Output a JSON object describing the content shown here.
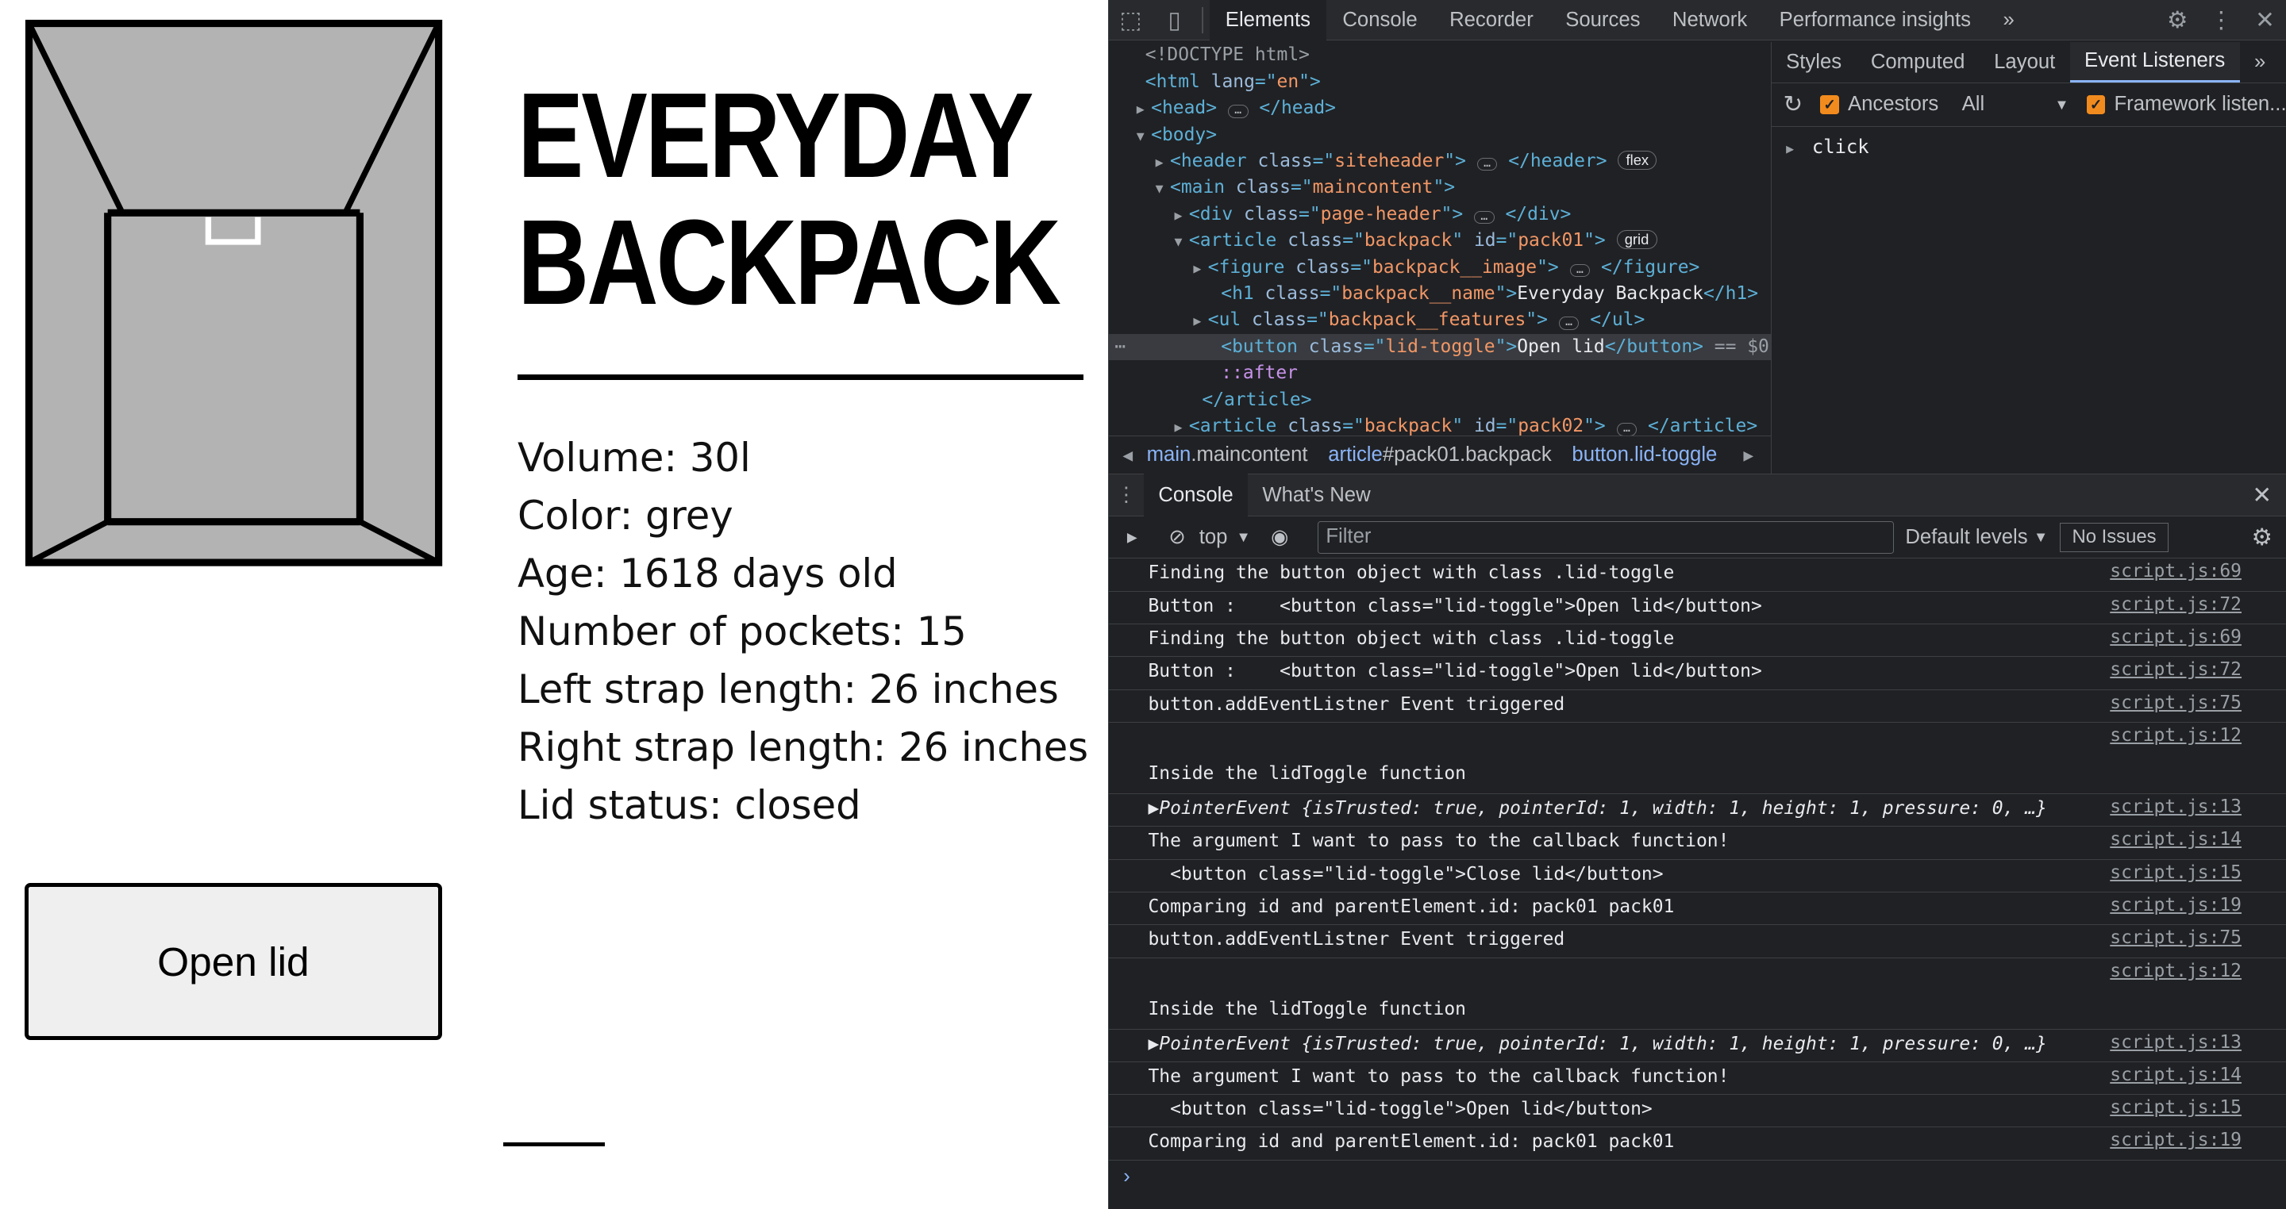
{
  "page": {
    "title": "EVERYDAY BACKPACK",
    "features": [
      "Volume: 30l",
      "Color: grey",
      "Age: 1618 days old",
      "Number of pockets: 15",
      "Left strap length: 26 inches",
      "Right strap length: 26 inches",
      "Lid status: closed"
    ],
    "lid_button": "Open lid"
  },
  "devtools": {
    "main_tabs": [
      "Elements",
      "Console",
      "Recorder",
      "Sources",
      "Network",
      "Performance insights"
    ],
    "more_tabs": "»",
    "elements_tree": [
      {
        "tokens": [
          {
            "c": "cm",
            "t": "<!DOCTYPE html>"
          }
        ]
      },
      {
        "tokens": [
          {
            "c": "tg",
            "t": "<html "
          },
          {
            "c": "an",
            "t": "lang"
          },
          {
            "c": "tg",
            "t": "=\""
          },
          {
            "c": "av",
            "t": "en"
          },
          {
            "c": "tg",
            "t": "\">"
          }
        ]
      },
      {
        "tri": "▶",
        "tokens": [
          {
            "c": "tg",
            "t": "<head>"
          }
        ],
        "ellipsis": true,
        "tail": [
          {
            "c": "tg",
            "t": "</head>"
          }
        ]
      },
      {
        "tri": "▼",
        "tokens": [
          {
            "c": "tg",
            "t": "<body>"
          }
        ]
      },
      {
        "tri": "▶",
        "tokens": [
          {
            "c": "tg",
            "t": "<header "
          },
          {
            "c": "an",
            "t": "class"
          },
          {
            "c": "tg",
            "t": "=\""
          },
          {
            "c": "av",
            "t": "siteheader"
          },
          {
            "c": "tg",
            "t": "\">"
          }
        ],
        "ellipsis": true,
        "tail": [
          {
            "c": "tg",
            "t": "</header>"
          }
        ],
        "badge": "flex"
      },
      {
        "tri": "▼",
        "tokens": [
          {
            "c": "tg",
            "t": "<main "
          },
          {
            "c": "an",
            "t": "class"
          },
          {
            "c": "tg",
            "t": "=\""
          },
          {
            "c": "av",
            "t": "maincontent"
          },
          {
            "c": "tg",
            "t": "\">"
          }
        ]
      },
      {
        "tri": "▶",
        "tokens": [
          {
            "c": "tg",
            "t": "<div "
          },
          {
            "c": "an",
            "t": "class"
          },
          {
            "c": "tg",
            "t": "=\""
          },
          {
            "c": "av",
            "t": "page-header"
          },
          {
            "c": "tg",
            "t": "\">"
          }
        ],
        "ellipsis": true,
        "tail": [
          {
            "c": "tg",
            "t": "</div>"
          }
        ]
      },
      {
        "tri": "▼",
        "tokens": [
          {
            "c": "tg",
            "t": "<article "
          },
          {
            "c": "an",
            "t": "class"
          },
          {
            "c": "tg",
            "t": "=\""
          },
          {
            "c": "av",
            "t": "backpack"
          },
          {
            "c": "tg",
            "t": "\" "
          },
          {
            "c": "an",
            "t": "id"
          },
          {
            "c": "tg",
            "t": "=\""
          },
          {
            "c": "av",
            "t": "pack01"
          },
          {
            "c": "tg",
            "t": "\">"
          }
        ],
        "badge": "grid"
      },
      {
        "tri": "▶",
        "tokens": [
          {
            "c": "tg",
            "t": "<figure "
          },
          {
            "c": "an",
            "t": "class"
          },
          {
            "c": "tg",
            "t": "=\""
          },
          {
            "c": "av",
            "t": "backpack__image"
          },
          {
            "c": "tg",
            "t": "\">"
          }
        ],
        "ellipsis": true,
        "tail": [
          {
            "c": "tg",
            "t": "</figure>"
          }
        ]
      },
      {
        "tokens": [
          {
            "c": "tg",
            "t": "<h1 "
          },
          {
            "c": "an",
            "t": "class"
          },
          {
            "c": "tg",
            "t": "=\""
          },
          {
            "c": "av",
            "t": "backpack__name"
          },
          {
            "c": "tg",
            "t": "\">"
          },
          {
            "c": "tx",
            "t": "Everyday Backpack"
          },
          {
            "c": "tg",
            "t": "</h1>"
          }
        ]
      },
      {
        "tri": "▶",
        "tokens": [
          {
            "c": "tg",
            "t": "<ul "
          },
          {
            "c": "an",
            "t": "class"
          },
          {
            "c": "tg",
            "t": "=\""
          },
          {
            "c": "av",
            "t": "backpack__features"
          },
          {
            "c": "tg",
            "t": "\">"
          }
        ],
        "ellipsis": true,
        "tail": [
          {
            "c": "tg",
            "t": "</ul>"
          }
        ]
      },
      {
        "sel": true,
        "tokens": [
          {
            "c": "tg",
            "t": "<button "
          },
          {
            "c": "an",
            "t": "class"
          },
          {
            "c": "tg",
            "t": "=\""
          },
          {
            "c": "av",
            "t": "lid-toggle"
          },
          {
            "c": "tg",
            "t": "\">"
          },
          {
            "c": "tx",
            "t": "Open lid"
          },
          {
            "c": "tg",
            "t": "</button>"
          },
          {
            "c": "cm",
            "t": " == $0"
          }
        ]
      },
      {
        "tokens": [
          {
            "c": "ps",
            "t": "::after"
          }
        ]
      },
      {
        "tokens": [
          {
            "c": "tg",
            "t": "</article>"
          }
        ]
      },
      {
        "tri": "▶",
        "tokens": [
          {
            "c": "tg",
            "t": "<article "
          },
          {
            "c": "an",
            "t": "class"
          },
          {
            "c": "tg",
            "t": "=\""
          },
          {
            "c": "av",
            "t": "backpack"
          },
          {
            "c": "tg",
            "t": "\" "
          },
          {
            "c": "an",
            "t": "id"
          },
          {
            "c": "tg",
            "t": "=\""
          },
          {
            "c": "av",
            "t": "pack02"
          },
          {
            "c": "tg",
            "t": "\">"
          }
        ],
        "ellipsis": true,
        "tail": [
          {
            "c": "tg",
            "t": "</article>"
          }
        ]
      }
    ],
    "breadcrumbs": [
      {
        "a": "main",
        "b": ".maincontent"
      },
      {
        "a": "article",
        "b": "#pack01.backpack"
      },
      {
        "a": "button",
        "b": ".lid-toggle"
      }
    ],
    "side_tabs": [
      "Styles",
      "Computed",
      "Layout",
      "Event Listeners"
    ],
    "side_more": "»",
    "ancestors_label": "Ancestors",
    "all_label": "All",
    "framework_label": "Framework listen...",
    "event_name": "click",
    "drawer_tabs": [
      "Console",
      "What's New"
    ],
    "context": "top",
    "filter_placeholder": "Filter",
    "levels": "Default levels",
    "no_issues": "No Issues",
    "console_lines": [
      {
        "text": "Finding the button object with class .lid-toggle",
        "src": "script.js:69"
      },
      {
        "text": "Button :    <button class=\"lid-toggle\">Open lid</button>",
        "src": "script.js:72"
      },
      {
        "text": "Finding the button object with class .lid-toggle",
        "src": "script.js:69"
      },
      {
        "text": "Button :    <button class=\"lid-toggle\">Open lid</button>",
        "src": "script.js:72"
      },
      {
        "text": "button.addEventListner Event triggered",
        "src": "script.js:75"
      },
      {
        "text": "Inside the lidToggle function",
        "src": "script.js:12",
        "tall": true
      },
      {
        "text": "▶PointerEvent {isTrusted: true, pointerId: 1, width: 1, height: 1, pressure: 0, …}",
        "src": "script.js:13",
        "obj": true
      },
      {
        "text": "The argument I want to pass to the callback function!",
        "src": "script.js:14"
      },
      {
        "text": "  <button class=\"lid-toggle\">Close lid</button>",
        "src": "script.js:15"
      },
      {
        "text": "Comparing id and parentElement.id: pack01 pack01",
        "src": "script.js:19"
      },
      {
        "text": "button.addEventListner Event triggered",
        "src": "script.js:75"
      },
      {
        "text": "Inside the lidToggle function",
        "src": "script.js:12",
        "tall": true
      },
      {
        "text": "▶PointerEvent {isTrusted: true, pointerId: 1, width: 1, height: 1, pressure: 0, …}",
        "src": "script.js:13",
        "obj": true
      },
      {
        "text": "The argument I want to pass to the callback function!",
        "src": "script.js:14"
      },
      {
        "text": "  <button class=\"lid-toggle\">Open lid</button>",
        "src": "script.js:15"
      },
      {
        "text": "Comparing id and parentElement.id: pack01 pack01",
        "src": "script.js:19"
      }
    ],
    "prompt_glyph": "›"
  }
}
